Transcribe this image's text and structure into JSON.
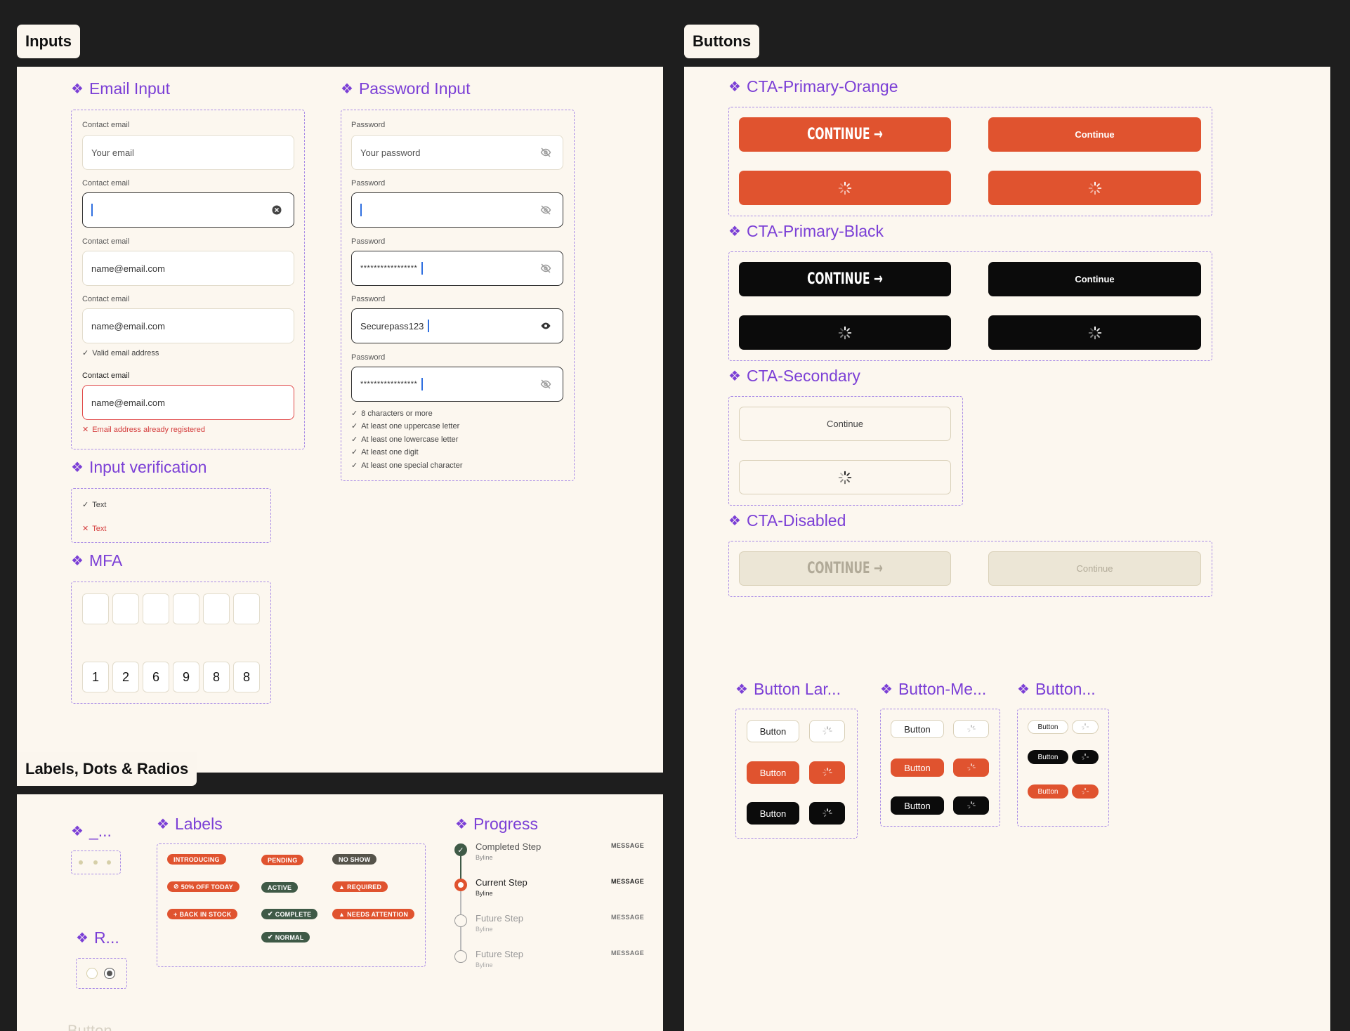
{
  "sections": {
    "inputs": "Inputs",
    "buttons": "Buttons",
    "labels": "Labels, Dots & Radios"
  },
  "email": {
    "title": "Email Input",
    "label": "Contact email",
    "placeholder": "Your email",
    "value": "name@email.com",
    "valid": "Valid email address",
    "error": "Email address already registered"
  },
  "password": {
    "title": "Password Input",
    "label": "Password",
    "placeholder": "Your password",
    "masked": "*****************",
    "plain": "Securepass123",
    "rules": [
      "8 characters or more",
      "At least one uppercase letter",
      "At least one lowercase letter",
      "At least one digit",
      "At least one special character"
    ]
  },
  "verification": {
    "title": "Input verification",
    "ok": "Text",
    "bad": "Text"
  },
  "mfa": {
    "title": "MFA",
    "digits": [
      "1",
      "2",
      "6",
      "9",
      "8",
      "8"
    ]
  },
  "cta": {
    "orange_title": "CTA-Primary-Orange",
    "black_title": "CTA-Primary-Black",
    "secondary_title": "CTA-Secondary",
    "disabled_title": "CTA-Disabled",
    "cond_label": "CONTINUE →",
    "label": "Continue"
  },
  "small_buttons": {
    "large_title": "Button Lar...",
    "medium_title": "Button-Me...",
    "small_title": "Button...",
    "label": "Button"
  },
  "dots": {
    "title": "_..."
  },
  "radios": {
    "title": "R..."
  },
  "labels": {
    "title": "Labels",
    "items": [
      "INTRODUCING",
      "50% OFF TODAY",
      "BACK IN STOCK",
      "PENDING",
      "ACTIVE",
      "COMPLETE",
      "NORMAL",
      "NO SHOW",
      "REQUIRED",
      "NEEDS ATTENTION"
    ]
  },
  "progress": {
    "title": "Progress",
    "steps": [
      {
        "title": "Completed Step",
        "byline": "Byline",
        "msg": "MESSAGE"
      },
      {
        "title": "Current Step",
        "byline": "Byline",
        "msg": "MESSAGE"
      },
      {
        "title": "Future Step",
        "byline": "Byline",
        "msg": "MESSAGE"
      },
      {
        "title": "Future Step",
        "byline": "Byline",
        "msg": "MESSAGE"
      }
    ]
  },
  "footer_peek": "Button",
  "colors": {
    "orange": "#e0532f",
    "black": "#0b0b0b",
    "purple": "#7b3fd6",
    "green": "#3f5a47",
    "canvas": "#1e1e1e",
    "panel": "#fcf7ef"
  }
}
